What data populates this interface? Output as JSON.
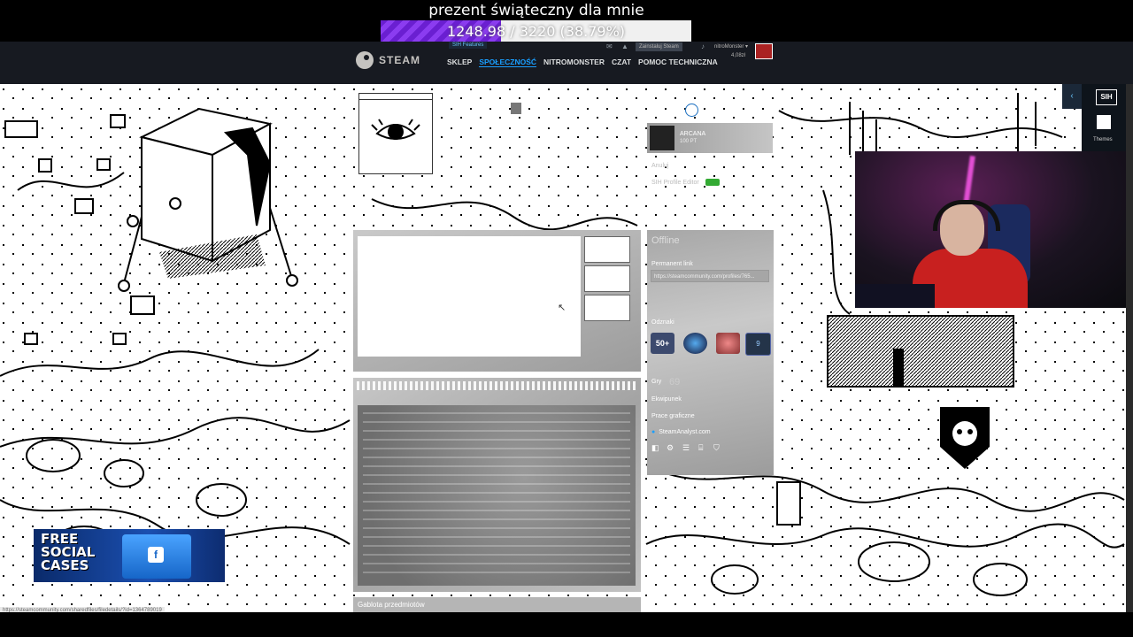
{
  "overlay": {
    "donation_title": "prezent świąteczny dla mnie",
    "donation_progress": "1248.98 / 3220 (38.79%)",
    "donation_fraction": 0.3879
  },
  "steam_header": {
    "logo_text": "STEAM",
    "sih_features": "SIH Features",
    "install_steam": "Zainstaluj Steam",
    "username": "nitroMonster ▾",
    "wallet": "4,08zł",
    "nav": [
      "SKLEP",
      "SPOŁECZNOŚĆ",
      "NITROMONSTER",
      "CZAT",
      "POMOC TECHNICZNA"
    ],
    "active_nav": "SPOŁECZNOŚĆ"
  },
  "profile": {
    "group_name": "ARCANA",
    "group_sub": "100 PT",
    "anuluj_label": "Anuluj",
    "sih_profile_editor": "SIH Profile Editor",
    "status": "Offline",
    "permanent_link_label": "Permanent link",
    "permanent_link_url": "https://steamcommunity.com/profiles/765...",
    "badges_label": "Odznaki",
    "badge_level": "50+",
    "badge_count": "9",
    "games_label": "Gry",
    "games_count": "69",
    "inventory_label": "Ekwipunek",
    "artwork_label": "Prace graficzne",
    "steamanalyst": "SteamAnalyst.com",
    "item_showcase_label": "Gablota przedmiotów"
  },
  "sidebar_right": {
    "sih_logo": "SIH",
    "themes_label": "Themes",
    "collapse_arrow": "‹"
  },
  "banner": {
    "line1": "FREE",
    "line2": "SOCIAL",
    "line3": "CASES",
    "fb_glyph": "f"
  },
  "status_url": "https://steamcommunity.com/sharedfiles/filedetails/?id=1364789019",
  "colors": {
    "steam_header": "#171a21",
    "active_link": "#1a9fff",
    "donation_fill": "#7b2fe6",
    "toggle_on": "#33aa33"
  }
}
